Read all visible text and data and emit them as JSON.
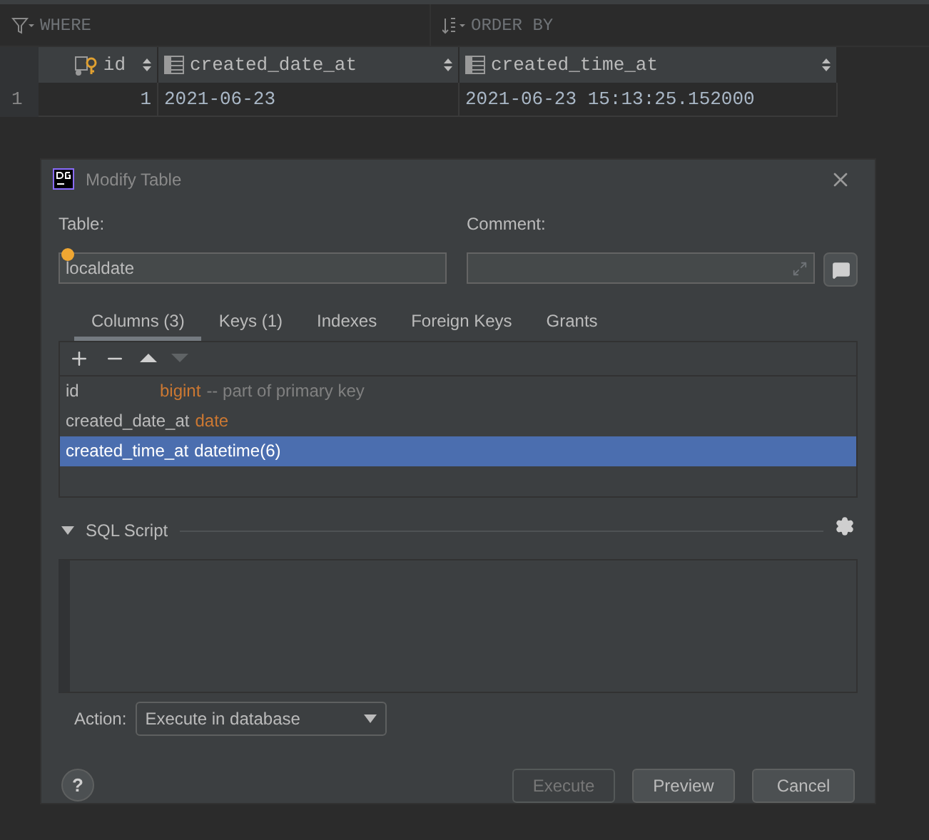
{
  "filters": [
    {
      "kind": "filter",
      "label": "WHERE"
    },
    {
      "kind": "sort",
      "label": "ORDER BY"
    }
  ],
  "grid": {
    "columns": [
      {
        "kind": "key",
        "label": "id"
      },
      {
        "kind": "column",
        "label": "created_date_at"
      },
      {
        "kind": "column",
        "label": "created_time_at"
      }
    ],
    "rows": [
      {
        "number": "1",
        "cells": [
          "1",
          "2021-06-23",
          "2021-06-23 15:13:25.152000"
        ]
      }
    ]
  },
  "dialog": {
    "title": "Modify Table",
    "table_label": "Table:",
    "table_value": "localdate",
    "comment_label": "Comment:",
    "tabs": [
      {
        "label": "Columns (3)",
        "selected": true
      },
      {
        "label": "Keys (1)",
        "selected": false
      },
      {
        "label": "Indexes",
        "selected": false
      },
      {
        "label": "Foreign Keys",
        "selected": false
      },
      {
        "label": "Grants",
        "selected": false
      }
    ],
    "columns": [
      {
        "name": "id",
        "type": "bigint",
        "comment": "-- part of primary key",
        "selected": false
      },
      {
        "name": "created_date_at",
        "type": "date",
        "selected": false
      },
      {
        "name": "created_time_at",
        "type": "datetime(6)",
        "selected": true
      }
    ],
    "section_title": "SQL Script",
    "action_label": "Action:",
    "action_value": "Execute in database",
    "help": "?",
    "buttons": [
      {
        "label": "Execute",
        "disabled": true
      },
      {
        "label": "Preview",
        "disabled": false
      },
      {
        "label": "Cancel",
        "disabled": false
      }
    ]
  }
}
